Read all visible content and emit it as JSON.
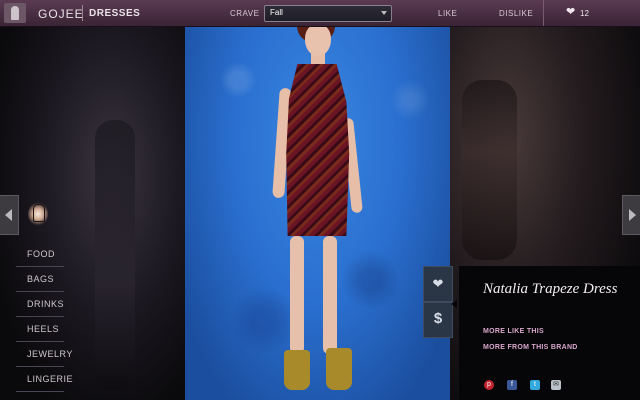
{
  "header": {
    "brand": "GOJEE",
    "section": "DRESSES",
    "crave_label": "CRAVE",
    "crave_selected": "Fall",
    "like_label": "LIKE",
    "dislike_label": "DISLIKE",
    "favorites_count": "12"
  },
  "sidebar": {
    "categories": [
      {
        "label": "FOOD"
      },
      {
        "label": "BAGS"
      },
      {
        "label": "DRINKS"
      },
      {
        "label": "HEELS"
      },
      {
        "label": "JEWELRY"
      },
      {
        "label": "LINGERIE"
      }
    ]
  },
  "product": {
    "title": "Natalia Trapeze Dress",
    "more_like_this": "MORE LIKE THIS",
    "more_from_brand": "MORE FROM THIS BRAND",
    "save_icon": "heart-icon",
    "price_icon": "dollar-icon"
  },
  "icons": {
    "heart_glyph": "❤",
    "dollar_glyph": "$",
    "pinterest_glyph": "p",
    "facebook_glyph": "f",
    "twitter_glyph": "t",
    "email_glyph": "✉"
  }
}
